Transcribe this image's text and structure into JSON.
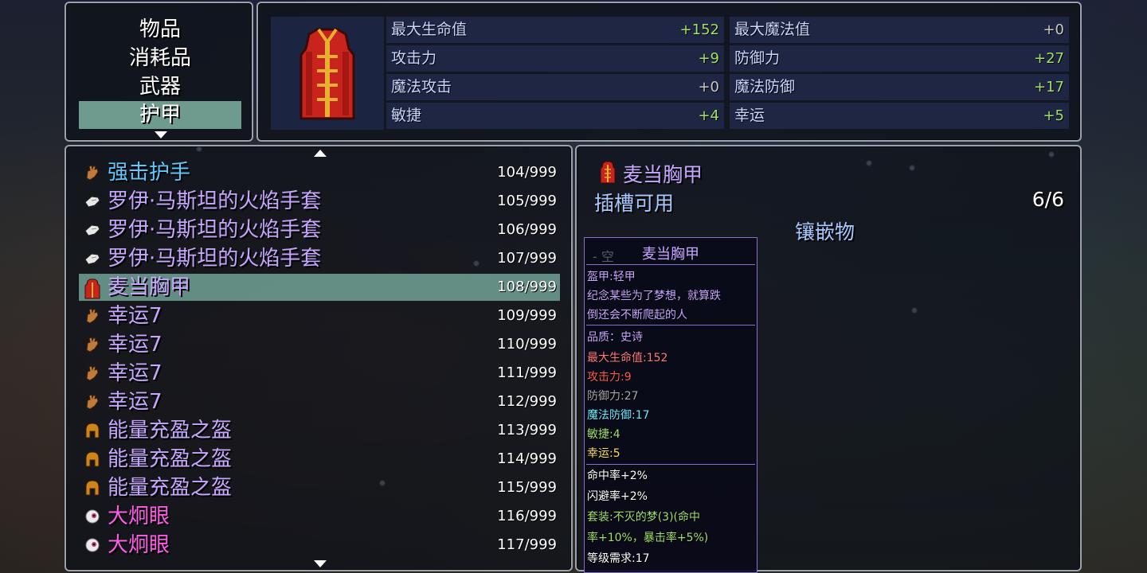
{
  "categories": [
    {
      "label": "物品"
    },
    {
      "label": "消耗品"
    },
    {
      "label": "武器"
    },
    {
      "label": "护甲"
    }
  ],
  "stats": [
    {
      "label": "最大生命值",
      "value": "+152"
    },
    {
      "label": "最大魔法值",
      "value": "+0"
    },
    {
      "label": "攻击力",
      "value": "+9"
    },
    {
      "label": "防御力",
      "value": "+27"
    },
    {
      "label": "魔法攻击",
      "value": "+0"
    },
    {
      "label": "魔法防御",
      "value": "+17"
    },
    {
      "label": "敏捷",
      "value": "+4"
    },
    {
      "label": "幸运",
      "value": "+5"
    }
  ],
  "items": [
    {
      "name": "强击护手",
      "count": "104/999",
      "color": "#5ec8ff",
      "icon": "gauntlet-icon"
    },
    {
      "name": "罗伊·马斯坦的火焰手套",
      "count": "105/999",
      "color": "#c7a6ff",
      "icon": "glove-icon"
    },
    {
      "name": "罗伊·马斯坦的火焰手套",
      "count": "106/999",
      "color": "#c7a6ff",
      "icon": "glove-icon"
    },
    {
      "name": "罗伊·马斯坦的火焰手套",
      "count": "107/999",
      "color": "#c7a6ff",
      "icon": "glove-icon"
    },
    {
      "name": "麦当胸甲",
      "count": "108/999",
      "color": "#c7a6ff",
      "icon": "chest-armor-icon"
    },
    {
      "name": "幸运7",
      "count": "109/999",
      "color": "#c7a6ff",
      "icon": "gauntlet-icon"
    },
    {
      "name": "幸运7",
      "count": "110/999",
      "color": "#c7a6ff",
      "icon": "gauntlet-icon"
    },
    {
      "name": "幸运7",
      "count": "111/999",
      "color": "#c7a6ff",
      "icon": "gauntlet-icon"
    },
    {
      "name": "幸运7",
      "count": "112/999",
      "color": "#c7a6ff",
      "icon": "gauntlet-icon"
    },
    {
      "name": "能量充盈之盔",
      "count": "113/999",
      "color": "#c7a6ff",
      "icon": "helmet-icon"
    },
    {
      "name": "能量充盈之盔",
      "count": "114/999",
      "color": "#c7a6ff",
      "icon": "helmet-icon"
    },
    {
      "name": "能量充盈之盔",
      "count": "115/999",
      "color": "#c7a6ff",
      "icon": "helmet-icon"
    },
    {
      "name": "大炯眼",
      "count": "116/999",
      "color": "#ff5ce8",
      "icon": "eyeball-icon"
    },
    {
      "name": "大炯眼",
      "count": "117/999",
      "color": "#ff5ce8",
      "icon": "eyeball-icon"
    }
  ],
  "detail": {
    "title": "麦当胸甲",
    "slots_label": "插槽可用",
    "slots_count": "6/6",
    "inlay_label": "镶嵌物"
  },
  "tooltip": {
    "ghost": "- 空",
    "title": "麦当胸甲",
    "lines": [
      {
        "text": "盔甲:轻甲",
        "color": "#c7a6ff"
      },
      {
        "text": "纪念某些为了梦想，就算跌",
        "color": "#c7a6ff"
      },
      {
        "text": "倒还会不断爬起的人",
        "color": "#c7a6ff"
      },
      {
        "text": "品质：史诗",
        "color": "#c7a6ff"
      },
      {
        "text": "最大生命值:152",
        "color": "#ff7a7a"
      },
      {
        "text": "攻击力:9",
        "color": "#ff5a4a"
      },
      {
        "text": "防御力:27",
        "color": "#a8a8a8"
      },
      {
        "text": "魔法防御:17",
        "color": "#6ee8ff"
      },
      {
        "text": "敏捷:4",
        "color": "#9fe06a"
      },
      {
        "text": "幸运:5",
        "color": "#ffe04a"
      },
      {
        "text": "命中率+2%",
        "color": "#ffffff"
      },
      {
        "text": "闪避率+2%",
        "color": "#ffffff"
      },
      {
        "text": "套装:不灭的梦(3)(命中",
        "color": "#9fe06a"
      },
      {
        "text": "率+10%，暴击率+5%)",
        "color": "#9fe06a"
      },
      {
        "text": "等级需求:17",
        "color": "#ffffff"
      }
    ]
  }
}
